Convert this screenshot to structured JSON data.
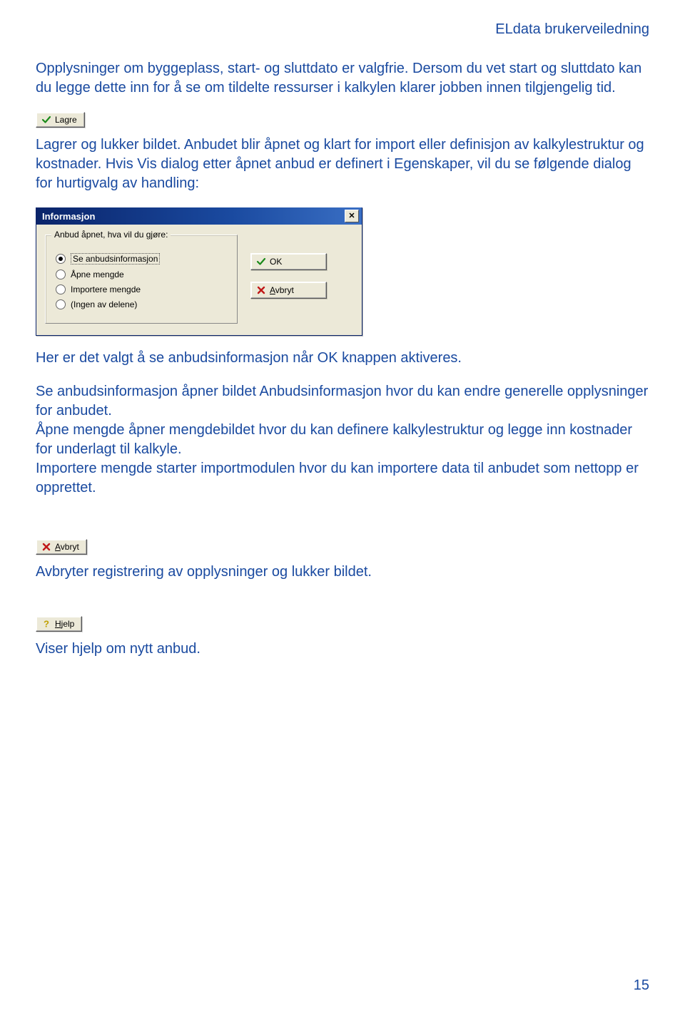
{
  "header": "ELdata brukerveiledning",
  "para1": "Opplysninger om byggeplass, start- og sluttdato er valgfrie.\nDersom du vet start og sluttdato kan du legge dette inn for å se om tildelte ressurser i kalkylen klarer jobben innen tilgjengelig tid.",
  "btn_lagre": "Lagre",
  "para2": "Lagrer og lukker bildet. Anbudet blir åpnet og klart for import eller definisjon av kalkylestruktur og kostnader. Hvis Vis dialog etter åpnet anbud er definert i Egenskaper, vil du se følgende dialog for hurtigvalg av handling:",
  "dialog": {
    "title": "Informasjon",
    "legend": "Anbud åpnet, hva vil du gjøre:",
    "options": [
      {
        "label": "Se anbudsinformasjon",
        "checked": true
      },
      {
        "label": "Åpne mengde",
        "checked": false
      },
      {
        "label": "Importere mengde",
        "checked": false
      },
      {
        "label": "(Ingen av delene)",
        "checked": false
      }
    ],
    "ok": "OK",
    "cancel_prefix": "A",
    "cancel_rest": "vbryt"
  },
  "para3": "Her er det valgt å se anbudsinformasjon når OK knappen aktiveres.",
  "para4": "Se anbudsinformasjon åpner bildet Anbudsinformasjon hvor du kan endre generelle opplysninger for anbudet.\nÅpne mengde åpner mengdebildet hvor du kan definere kalkylestruktur og legge inn kostnader for underlagt til kalkyle.\nImportere mengde starter importmodulen hvor du kan importere data til anbudet som nettopp er opprettet.",
  "btn_avbryt_prefix": "A",
  "btn_avbryt_rest": "vbryt",
  "para5": "Avbryter registrering av opplysninger og lukker bildet.",
  "btn_hjelp_prefix": "H",
  "btn_hjelp_rest": "jelp",
  "para6": "Viser hjelp om nytt anbud.",
  "pagenum": "15"
}
